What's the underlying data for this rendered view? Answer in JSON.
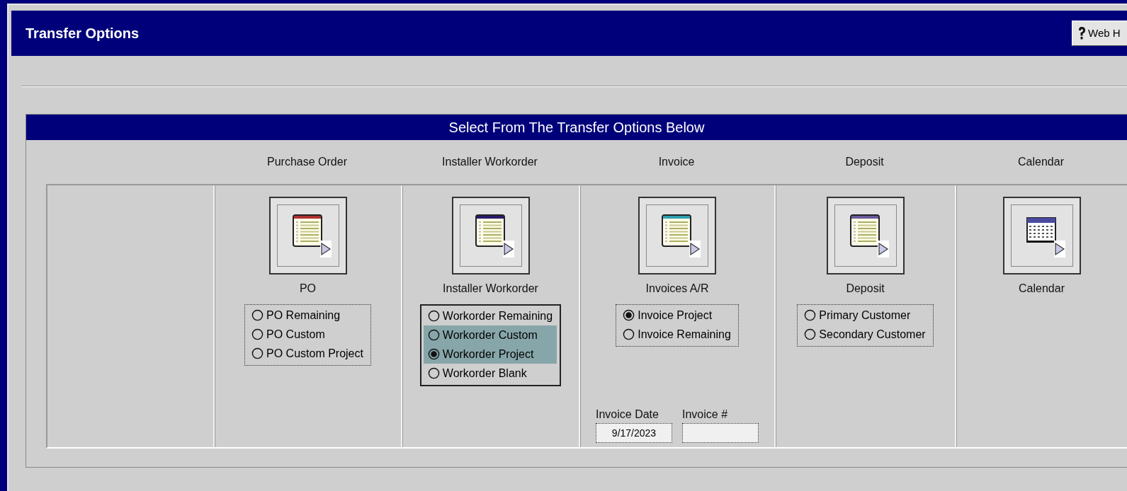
{
  "window": {
    "title": "Transfer Options",
    "help_button": "Web H"
  },
  "panel": {
    "title": "Select From The Transfer Options Below"
  },
  "columns": [
    {
      "header": "Purchase Order",
      "icon": {
        "kind": "document",
        "color": "#b03030"
      },
      "label": "PO",
      "focused": false,
      "options": [
        {
          "label": "PO Remaining",
          "selected": false,
          "highlighted": false
        },
        {
          "label": "PO Custom",
          "selected": false,
          "highlighted": false
        },
        {
          "label": "PO Custom Project",
          "selected": false,
          "highlighted": false
        }
      ]
    },
    {
      "header": "Installer Workorder",
      "icon": {
        "kind": "document",
        "color": "#2a1a6a"
      },
      "label": "Installer Workorder",
      "focused": true,
      "options": [
        {
          "label": "Workorder Remaining",
          "selected": false,
          "highlighted": false
        },
        {
          "label": "Workorder Custom",
          "selected": false,
          "highlighted": true
        },
        {
          "label": "Workorder Project",
          "selected": true,
          "highlighted": true
        },
        {
          "label": "Workorder Blank",
          "selected": false,
          "highlighted": false
        }
      ]
    },
    {
      "header": "Invoice",
      "icon": {
        "kind": "document",
        "color": "#30a0b0"
      },
      "label": "Invoices A/R",
      "focused": false,
      "options": [
        {
          "label": "Invoice Project",
          "selected": true,
          "highlighted": false
        },
        {
          "label": "Invoice Remaining",
          "selected": false,
          "highlighted": false
        }
      ],
      "fields": [
        {
          "label": "Invoice Date",
          "value": "9/17/2023"
        },
        {
          "label": "Invoice #"
        }
      ]
    },
    {
      "header": "Deposit",
      "icon": {
        "kind": "document",
        "color": "#6a5a9a"
      },
      "label": "Deposit",
      "focused": false,
      "options": [
        {
          "label": "Primary Customer",
          "selected": false,
          "highlighted": false
        },
        {
          "label": "Secondary Customer",
          "selected": false,
          "highlighted": false
        }
      ]
    },
    {
      "header": "Calendar",
      "icon": {
        "kind": "calendar",
        "color": "#4a4aa0"
      },
      "label": "Calendar"
    }
  ]
}
